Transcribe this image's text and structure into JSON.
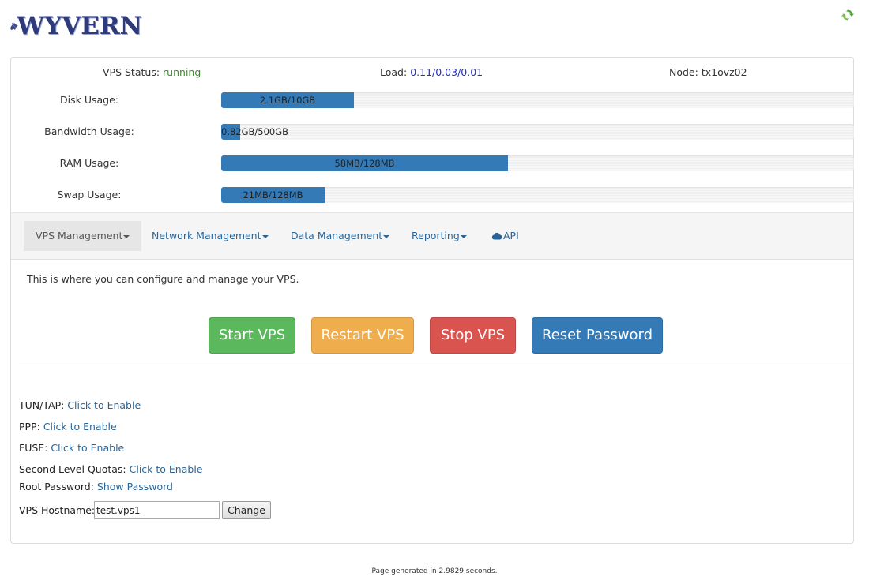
{
  "header": {
    "logo_text": "WYVERN",
    "refresh_icon": "refresh-icon"
  },
  "status": {
    "vps_status_label": "VPS Status:",
    "vps_status_value": "running",
    "load_label": "Load:",
    "load_value": "0.11/0.03/0.01",
    "node_label": "Node:",
    "node_value": "tx1ovz02",
    "running_color": "#3c8a2e",
    "load_color": "#2030c0"
  },
  "usage": [
    {
      "label": "Disk Usage:",
      "text": "2.1GB/10GB",
      "fraction": 0.21
    },
    {
      "label": "Bandwidth Usage:",
      "text": "0.82GB/500GB",
      "fraction": 0.03
    },
    {
      "label": "RAM Usage:",
      "text": "58MB/128MB",
      "fraction": 0.453
    },
    {
      "label": "Swap Usage:",
      "text": "21MB/128MB",
      "fraction": 0.164
    }
  ],
  "nav": {
    "vps_management": "VPS Management",
    "network_management": "Network Management",
    "data_management": "Data Management",
    "reporting": "Reporting",
    "api": "API"
  },
  "intro_text": "This is where you can configure and manage your VPS.",
  "actions": {
    "start": "Start VPS",
    "restart": "Restart VPS",
    "stop": "Stop VPS",
    "reset_password": "Reset Password"
  },
  "options": {
    "tuntap_label": "TUN/TAP:",
    "tuntap_link": "Click to Enable",
    "ppp_label": "PPP:",
    "ppp_link": "Click to Enable",
    "fuse_label": "FUSE:",
    "fuse_link": "Click to Enable",
    "quotas_label": "Second Level Quotas:",
    "quotas_link": "Click to Enable",
    "root_label": "Root Password:",
    "root_link": "Show Password",
    "hostname_label": "VPS Hostname:",
    "hostname_value": "test.vps1",
    "change_label": "Change"
  },
  "footer_text": "Page generated in 2.9829 seconds.",
  "colors": {
    "accent": "#337ab7",
    "success": "#5cb85c",
    "warning": "#f0ad4e",
    "danger": "#d9534f",
    "link": "#2a6496"
  }
}
